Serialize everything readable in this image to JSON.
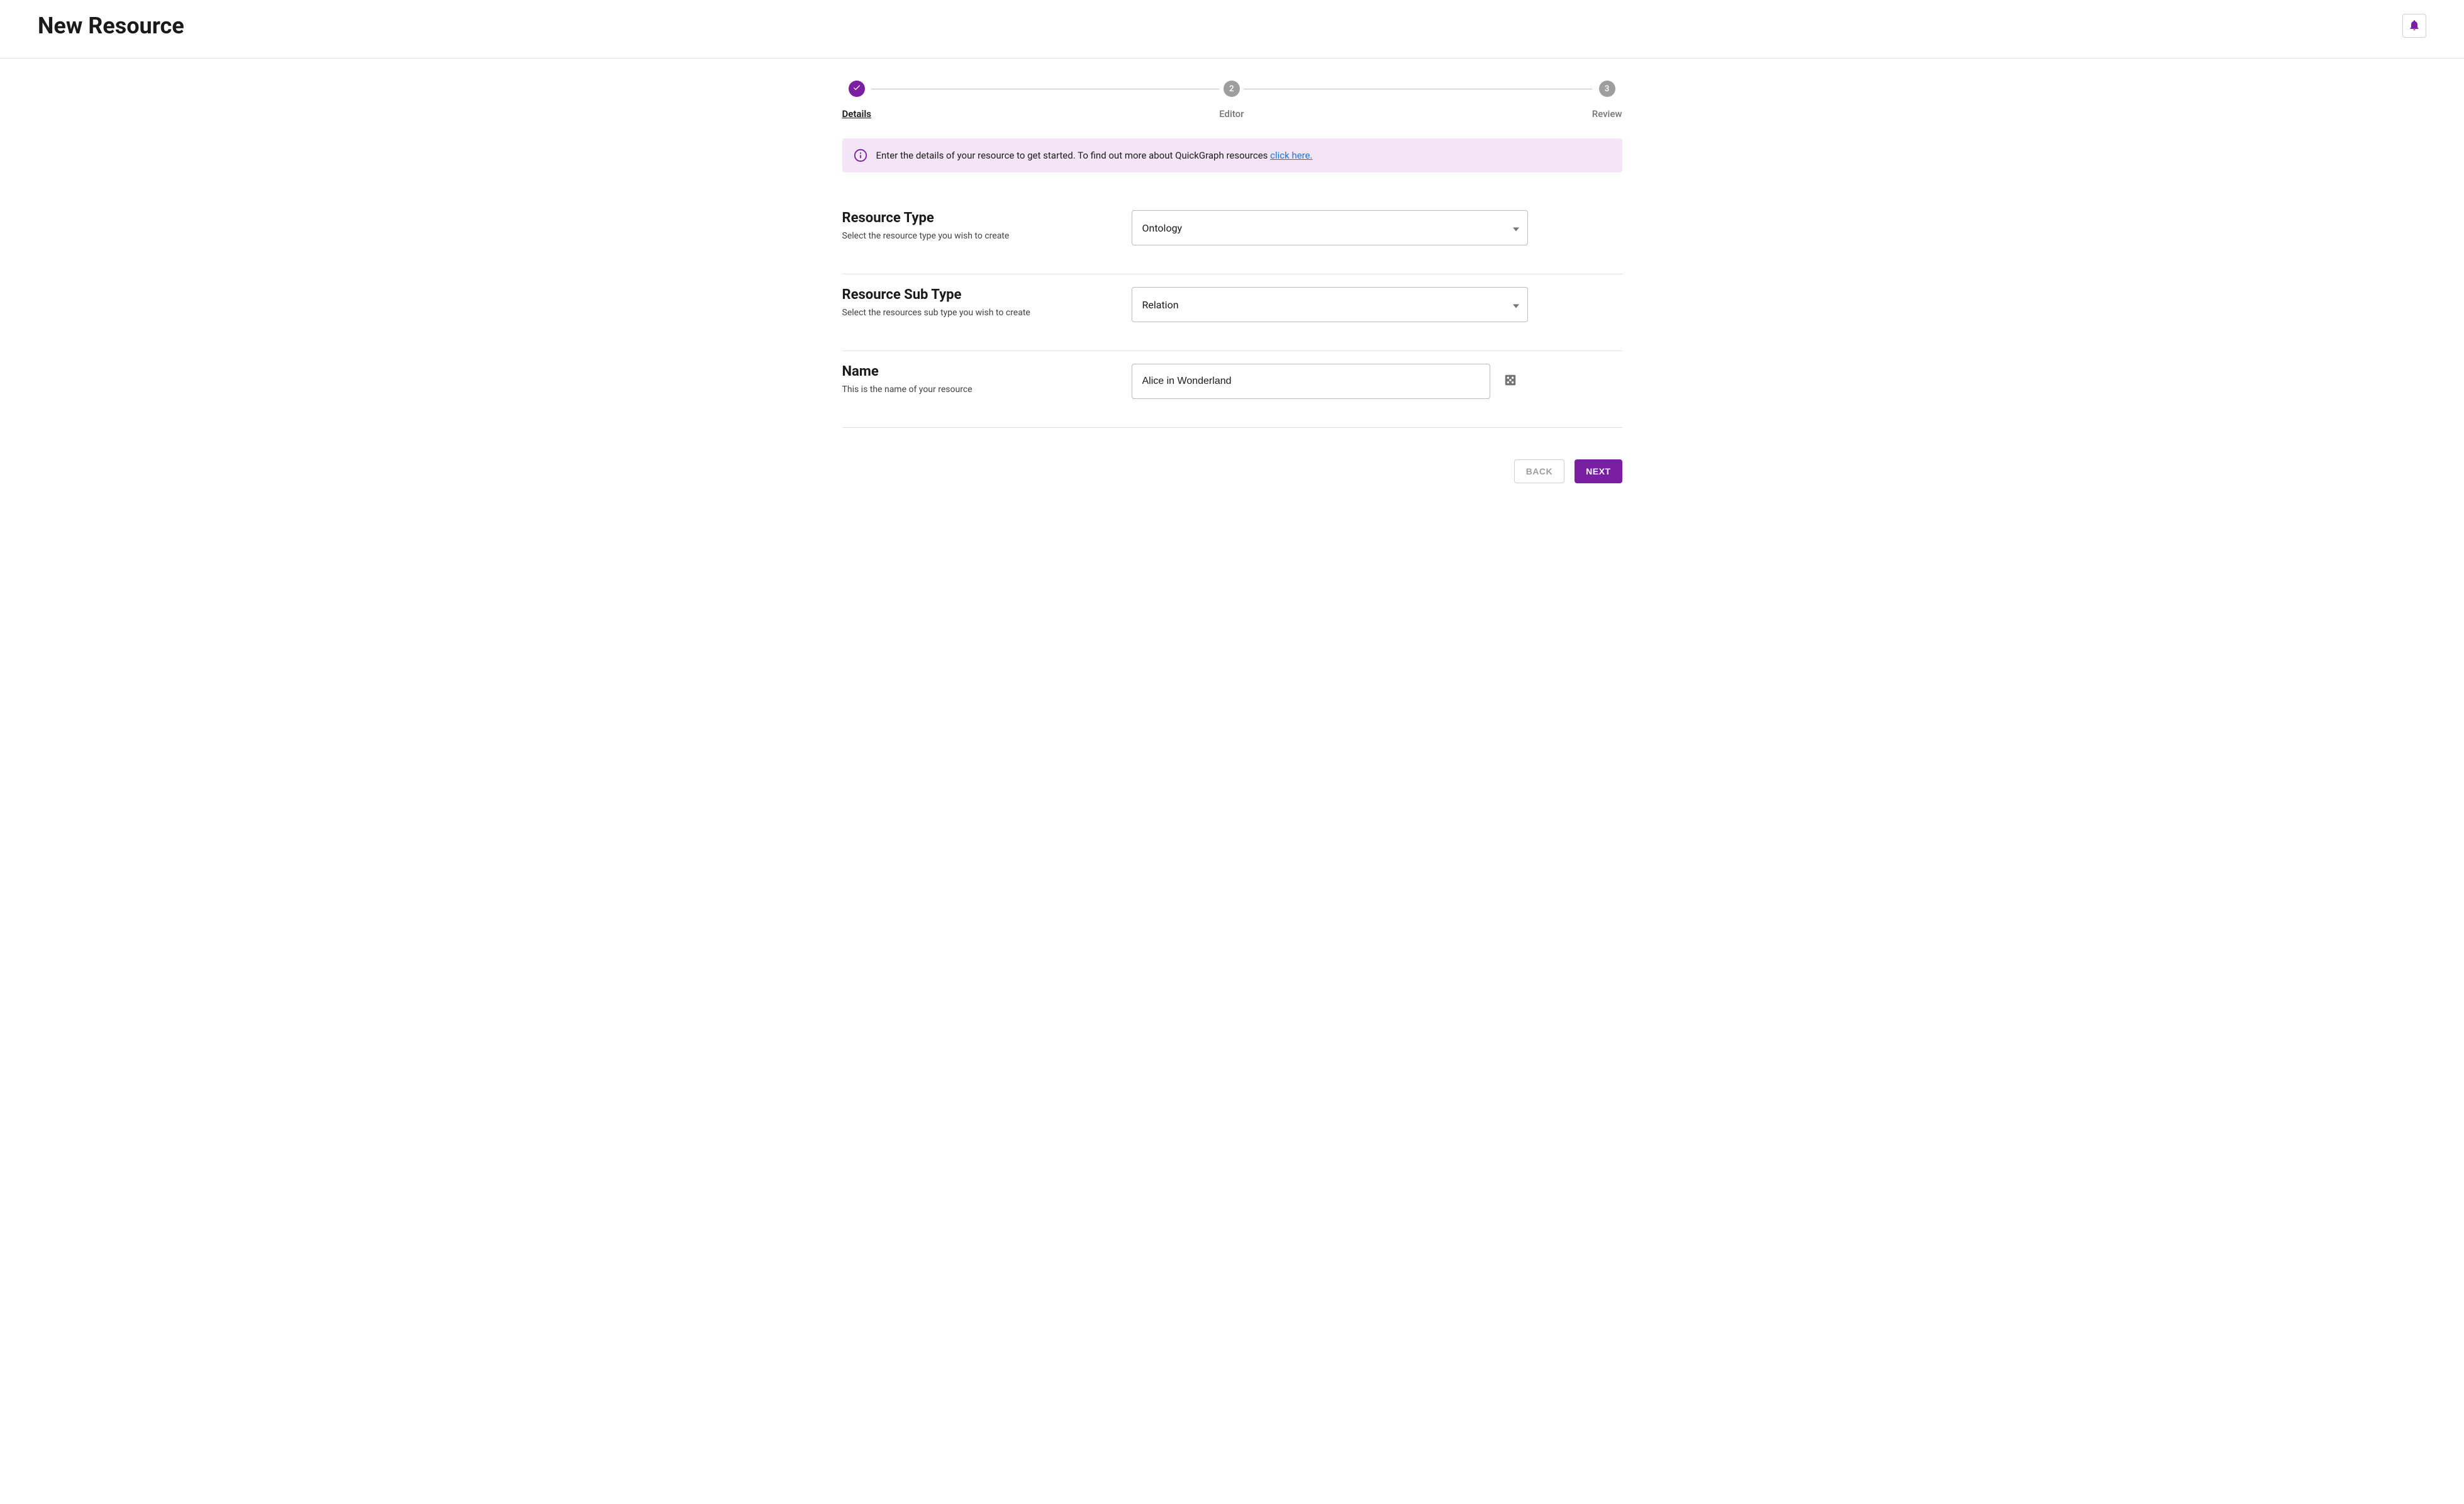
{
  "header": {
    "title": "New Resource"
  },
  "stepper": {
    "steps": [
      {
        "label": "Details",
        "state": "active",
        "icon": "check"
      },
      {
        "label": "Editor",
        "state": "inactive",
        "number": "2"
      },
      {
        "label": "Review",
        "state": "inactive",
        "number": "3"
      }
    ]
  },
  "info": {
    "text": "Enter the details of your resource to get started. To find out more about QuickGraph resources ",
    "link_text": "click here."
  },
  "form": {
    "resource_type": {
      "title": "Resource Type",
      "desc": "Select the resource type you wish to create",
      "value": "Ontology"
    },
    "resource_subtype": {
      "title": "Resource Sub Type",
      "desc": "Select the resources sub type you wish to create",
      "value": "Relation"
    },
    "name": {
      "title": "Name",
      "desc": "This is the name of your resource",
      "value": "Alice in Wonderland"
    }
  },
  "footer": {
    "back_label": "Back",
    "next_label": "Next"
  }
}
